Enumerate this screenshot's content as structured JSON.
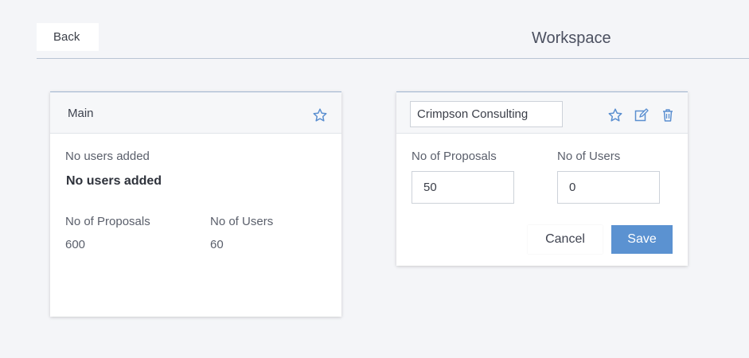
{
  "header": {
    "back_label": "Back",
    "title": "Workspace"
  },
  "main_card": {
    "title": "Main",
    "users_status": "No users added",
    "users_status_bold": "No users added",
    "proposals_label": "No of Proposals",
    "proposals_value": "600",
    "users_label": "No of Users",
    "users_value": "60"
  },
  "edit_card": {
    "name_value": "Crimpson Consulting",
    "proposals_label": "No of Proposals",
    "proposals_value": "50",
    "users_label": "No of Users",
    "users_value": "0",
    "cancel_label": "Cancel",
    "save_label": "Save"
  },
  "icons": {
    "favorite": "star-outline-icon",
    "edit": "edit-icon",
    "delete": "trash-icon"
  },
  "colors": {
    "accent": "#5b92d1",
    "icon": "#5b8fd0",
    "background": "#f4f5f8"
  }
}
